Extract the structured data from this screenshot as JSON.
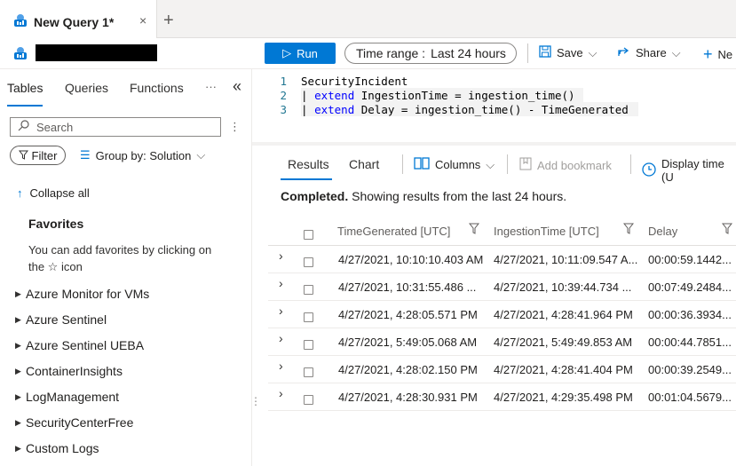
{
  "tab": {
    "title": "New Query 1*",
    "close": "×",
    "add": "+"
  },
  "toolbar": {
    "run": "Run",
    "time_range_label": "Time range :",
    "time_range_value": "Last 24 hours",
    "save": "Save",
    "share": "Share",
    "new_alert": "Ne"
  },
  "left": {
    "tabs": [
      "Tables",
      "Queries",
      "Functions"
    ],
    "more": "···",
    "collapse": "«",
    "search_placeholder": "Search",
    "filter": "Filter",
    "group_by": "Group by: Solution",
    "collapse_all": "Collapse all",
    "favorites_title": "Favorites",
    "favorites_hint_1": "You can add favorites by clicking on",
    "favorites_hint_2": "the ☆ icon",
    "tree": [
      "Azure Monitor for VMs",
      "Azure Sentinel",
      "Azure Sentinel UEBA",
      "ContainerInsights",
      "LogManagement",
      "SecurityCenterFree",
      "Custom Logs"
    ]
  },
  "editor": {
    "line_numbers": [
      "1",
      "2",
      "3"
    ],
    "line1": "SecurityIncident",
    "line2_pipe": "| ",
    "line2_kw": "extend",
    "line2_rest": " IngestionTime = ingestion_time()",
    "line3_pipe": "| ",
    "line3_kw": "extend",
    "line3_rest": " Delay = ingestion_time() - TimeGenerated"
  },
  "results": {
    "tabs": [
      "Results",
      "Chart"
    ],
    "columns": "Columns",
    "add_bookmark": "Add bookmark",
    "display_time": "Display time (U",
    "status_bold": "Completed.",
    "status_text": " Showing results from the last 24 hours.",
    "headers": [
      "TimeGenerated [UTC]",
      "IngestionTime [UTC]",
      "Delay"
    ],
    "rows": [
      [
        "4/27/2021, 10:10:10.403 AM",
        "4/27/2021, 10:11:09.547 A...",
        "00:00:59.1442..."
      ],
      [
        "4/27/2021, 10:31:55.486 ...",
        "4/27/2021, 10:39:44.734 ...",
        "00:07:49.2484..."
      ],
      [
        "4/27/2021, 4:28:05.571 PM",
        "4/27/2021, 4:28:41.964 PM",
        "00:00:36.3934..."
      ],
      [
        "4/27/2021, 5:49:05.068 AM",
        "4/27/2021, 5:49:49.853 AM",
        "00:00:44.7851..."
      ],
      [
        "4/27/2021, 4:28:02.150 PM",
        "4/27/2021, 4:28:41.404 PM",
        "00:00:39.2549..."
      ],
      [
        "4/27/2021, 4:28:30.931 PM",
        "4/27/2021, 4:29:35.498 PM",
        "00:01:04.5679..."
      ]
    ]
  },
  "colors": {
    "accent": "#0078d4",
    "keyword": "#0000ff"
  }
}
